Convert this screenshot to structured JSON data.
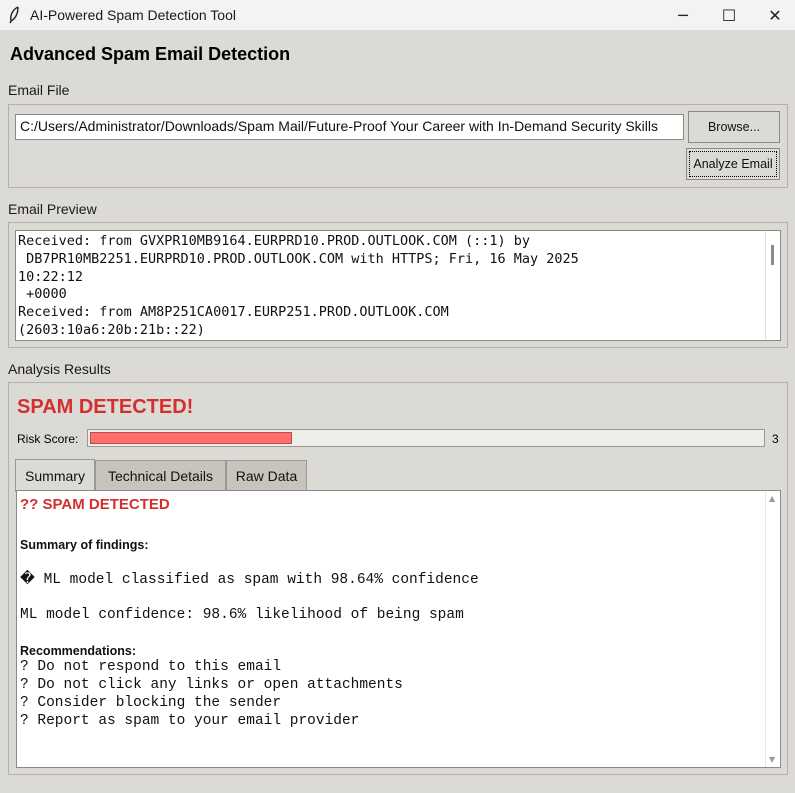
{
  "window": {
    "title": "AI-Powered Spam Detection Tool",
    "icon": "feather-icon",
    "controls": {
      "minimize": "─",
      "maximize": "☐",
      "close": "✕"
    }
  },
  "heading": "Advanced Spam Email Detection",
  "email_file": {
    "label": "Email File",
    "path": "C:/Users/Administrator/Downloads/Spam Mail/Future-Proof Your Career with In-Demand Security Skills",
    "browse_label": "Browse...",
    "analyze_label": "Analyze Email"
  },
  "preview": {
    "label": "Email Preview",
    "lines": [
      "Received: from GVXPR10MB9164.EURPRD10.PROD.OUTLOOK.COM (::1) by",
      " DB7PR10MB2251.EURPRD10.PROD.OUTLOOK.COM with HTTPS; Fri, 16 May 2025",
      "10:22:12",
      " +0000",
      "Received: from AM8P251CA0017.EURP251.PROD.OUTLOOK.COM",
      "(2603:10a6:20b:21b::22)"
    ]
  },
  "results": {
    "label": "Analysis Results",
    "status": "SPAM DETECTED!",
    "status_color": "#d32f2f",
    "risk_label": "Risk Score:",
    "risk_value": "3",
    "risk_fraction": 0.3,
    "tabs": [
      "Summary",
      "Technical Details",
      "Raw Data"
    ],
    "active_tab": "Summary"
  },
  "summary": {
    "title": "?? SPAM DETECTED",
    "findings_heading": "Summary of findings:",
    "finding": "� ML model classified as spam with 98.64% confidence",
    "confidence": "ML model confidence: 98.6% likelihood of being spam",
    "recommendations_heading": "Recommendations:",
    "recommendations": [
      "? Do not respond to this email",
      "? Do not click any links or open attachments",
      "? Consider blocking the sender",
      "? Report as spam to your email provider"
    ]
  }
}
